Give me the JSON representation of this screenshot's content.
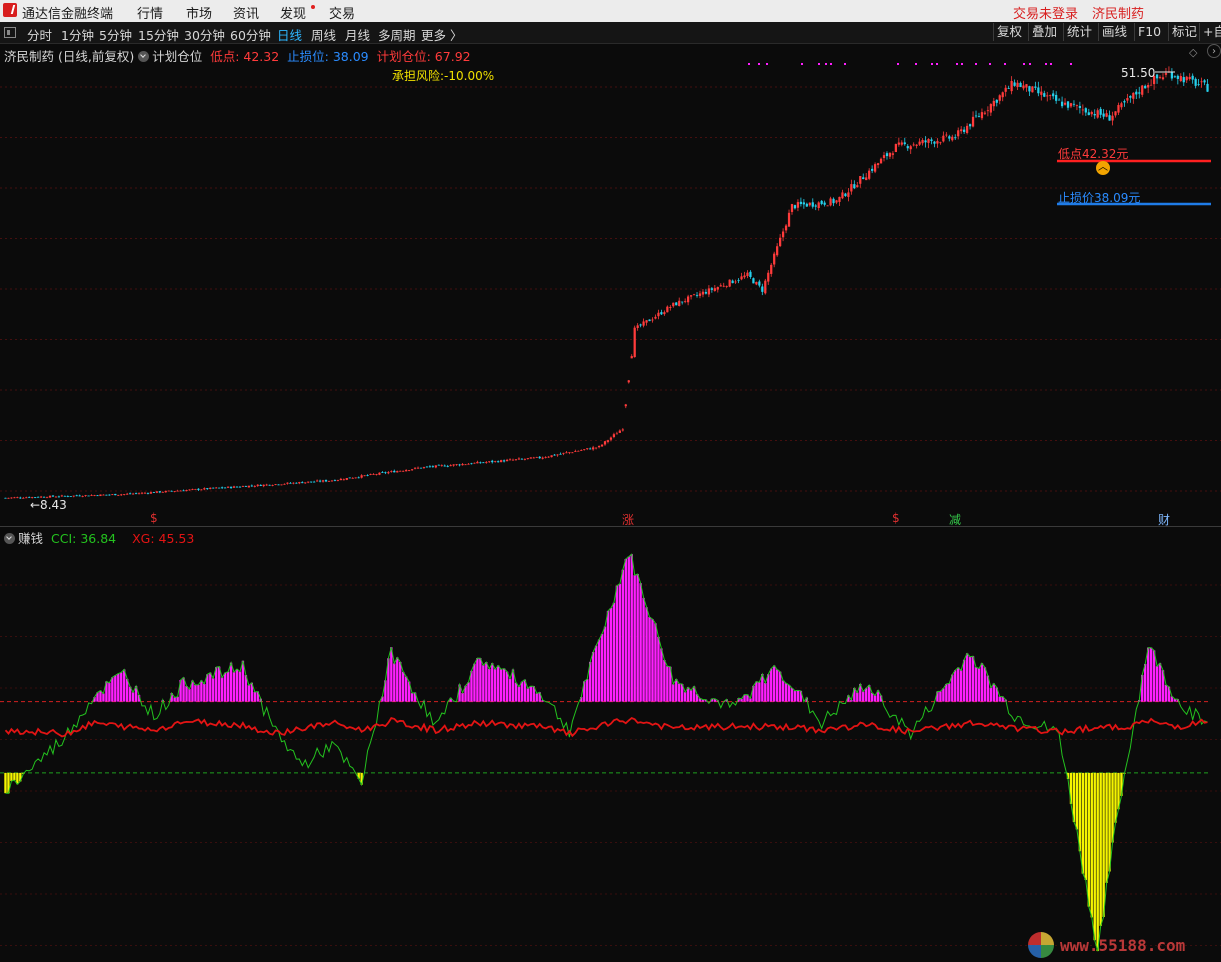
{
  "window": {
    "title": "通达信金融终端"
  },
  "top_menu": [
    "行情",
    "市场",
    "资讯",
    "发现",
    "交易"
  ],
  "top_right": {
    "login_status": "交易未登录",
    "stock_name": "济民制药"
  },
  "periods": [
    "分时",
    "1分钟",
    "5分钟",
    "15分钟",
    "30分钟",
    "60分钟",
    "日线",
    "周线",
    "月线",
    "多周期",
    "更多 〉"
  ],
  "active_period": "日线",
  "right_tools": [
    "复权",
    "叠加",
    "统计",
    "画线",
    "F10",
    "标记",
    "+自"
  ],
  "main_legend": {
    "title": "济民制药 (日线,前复权)",
    "indicator": "计划仓位",
    "low_label": "低点: 42.32",
    "stop_label": "止损位: 38.09",
    "plan_label": "计划仓位: 67.92"
  },
  "risk_text": "承担风险:-10.00%",
  "price_labels": {
    "high": "51.50",
    "low_marker": "低点42.32元",
    "stop_marker": "止损价38.09元",
    "start": "←8.43"
  },
  "event_markers": [
    {
      "text": "$",
      "color": "#e03030"
    },
    {
      "text": "涨",
      "color": "#e03030"
    },
    {
      "text": "$",
      "color": "#e03030"
    },
    {
      "text": "减",
      "color": "#35c84a"
    },
    {
      "text": "财",
      "color": "#7fb8ff"
    }
  ],
  "sub_legend": {
    "name": "赚钱",
    "cci": "CCI: 36.84",
    "xg": "XG: 45.53"
  },
  "watermark": "www.55188.com",
  "colors": {
    "up": "#ff3b3b",
    "down": "#25d0ec",
    "magenta": "#ff1fff",
    "cci": "#24c21f",
    "xg": "#e31414",
    "yellow": "#f5f500"
  },
  "chart_data": {
    "type": "candlestick",
    "price_key_points": [
      {
        "bar": 0,
        "close": 8.43
      },
      {
        "bar": 40,
        "close": 8.8
      },
      {
        "bar": 80,
        "close": 9.6
      },
      {
        "bar": 110,
        "close": 10.2
      },
      {
        "bar": 140,
        "close": 11.5
      },
      {
        "bar": 180,
        "close": 12.5
      },
      {
        "bar": 200,
        "close": 13.6
      },
      {
        "bar": 208,
        "close": 15.5
      },
      {
        "bar": 212,
        "close": 25.5
      },
      {
        "bar": 225,
        "close": 28.0
      },
      {
        "bar": 250,
        "close": 31.0
      },
      {
        "bar": 255,
        "close": 29.5
      },
      {
        "bar": 265,
        "close": 38.0
      },
      {
        "bar": 280,
        "close": 38.5
      },
      {
        "bar": 300,
        "close": 44.0
      },
      {
        "bar": 320,
        "close": 45.0
      },
      {
        "bar": 340,
        "close": 50.5
      },
      {
        "bar": 355,
        "close": 48.5
      },
      {
        "bar": 372,
        "close": 47.0
      },
      {
        "bar": 385,
        "close": 50.5
      },
      {
        "bar": 392,
        "close": 51.5
      },
      {
        "bar": 405,
        "close": 50.0
      }
    ],
    "low_level": 42.32,
    "stop_level": 38.09,
    "high_value": 51.5,
    "start_value": 8.43,
    "indicator_key_points": [
      {
        "bar": 0,
        "cci": -150,
        "xg": 20
      },
      {
        "bar": 20,
        "cci": 0,
        "xg": 10
      },
      {
        "bar": 30,
        "cci": 120,
        "xg": 40
      },
      {
        "bar": 40,
        "cci": 180,
        "xg": 30
      },
      {
        "bar": 50,
        "cci": 60,
        "xg": 20
      },
      {
        "bar": 60,
        "cci": 150,
        "xg": 45
      },
      {
        "bar": 80,
        "cci": 200,
        "xg": 35
      },
      {
        "bar": 90,
        "cci": 30,
        "xg": 10
      },
      {
        "bar": 100,
        "cci": -80,
        "xg": 25
      },
      {
        "bar": 110,
        "cci": -20,
        "xg": 40
      },
      {
        "bar": 120,
        "cci": -130,
        "xg": 20
      },
      {
        "bar": 130,
        "cci": 240,
        "xg": 45
      },
      {
        "bar": 145,
        "cci": 30,
        "xg": 20
      },
      {
        "bar": 160,
        "cci": 220,
        "xg": 40
      },
      {
        "bar": 180,
        "cci": 130,
        "xg": 30
      },
      {
        "bar": 190,
        "cci": 20,
        "xg": 10
      },
      {
        "bar": 210,
        "cci": 520,
        "xg": 50
      },
      {
        "bar": 225,
        "cci": 160,
        "xg": 25
      },
      {
        "bar": 245,
        "cci": 80,
        "xg": 30
      },
      {
        "bar": 260,
        "cci": 200,
        "xg": 30
      },
      {
        "bar": 275,
        "cci": 40,
        "xg": 20
      },
      {
        "bar": 290,
        "cci": 150,
        "xg": 35
      },
      {
        "bar": 305,
        "cci": 10,
        "xg": 15
      },
      {
        "bar": 325,
        "cci": 240,
        "xg": 40
      },
      {
        "bar": 340,
        "cci": 60,
        "xg": 25
      },
      {
        "bar": 355,
        "cci": 10,
        "xg": 15
      },
      {
        "bar": 368,
        "cci": -600,
        "xg": 30
      },
      {
        "bar": 375,
        "cci": -200,
        "xg": 25
      },
      {
        "bar": 385,
        "cci": 260,
        "xg": 45
      },
      {
        "bar": 395,
        "cci": 100,
        "xg": 30
      },
      {
        "bar": 405,
        "cci": 36.84,
        "xg": 45.53
      }
    ]
  }
}
